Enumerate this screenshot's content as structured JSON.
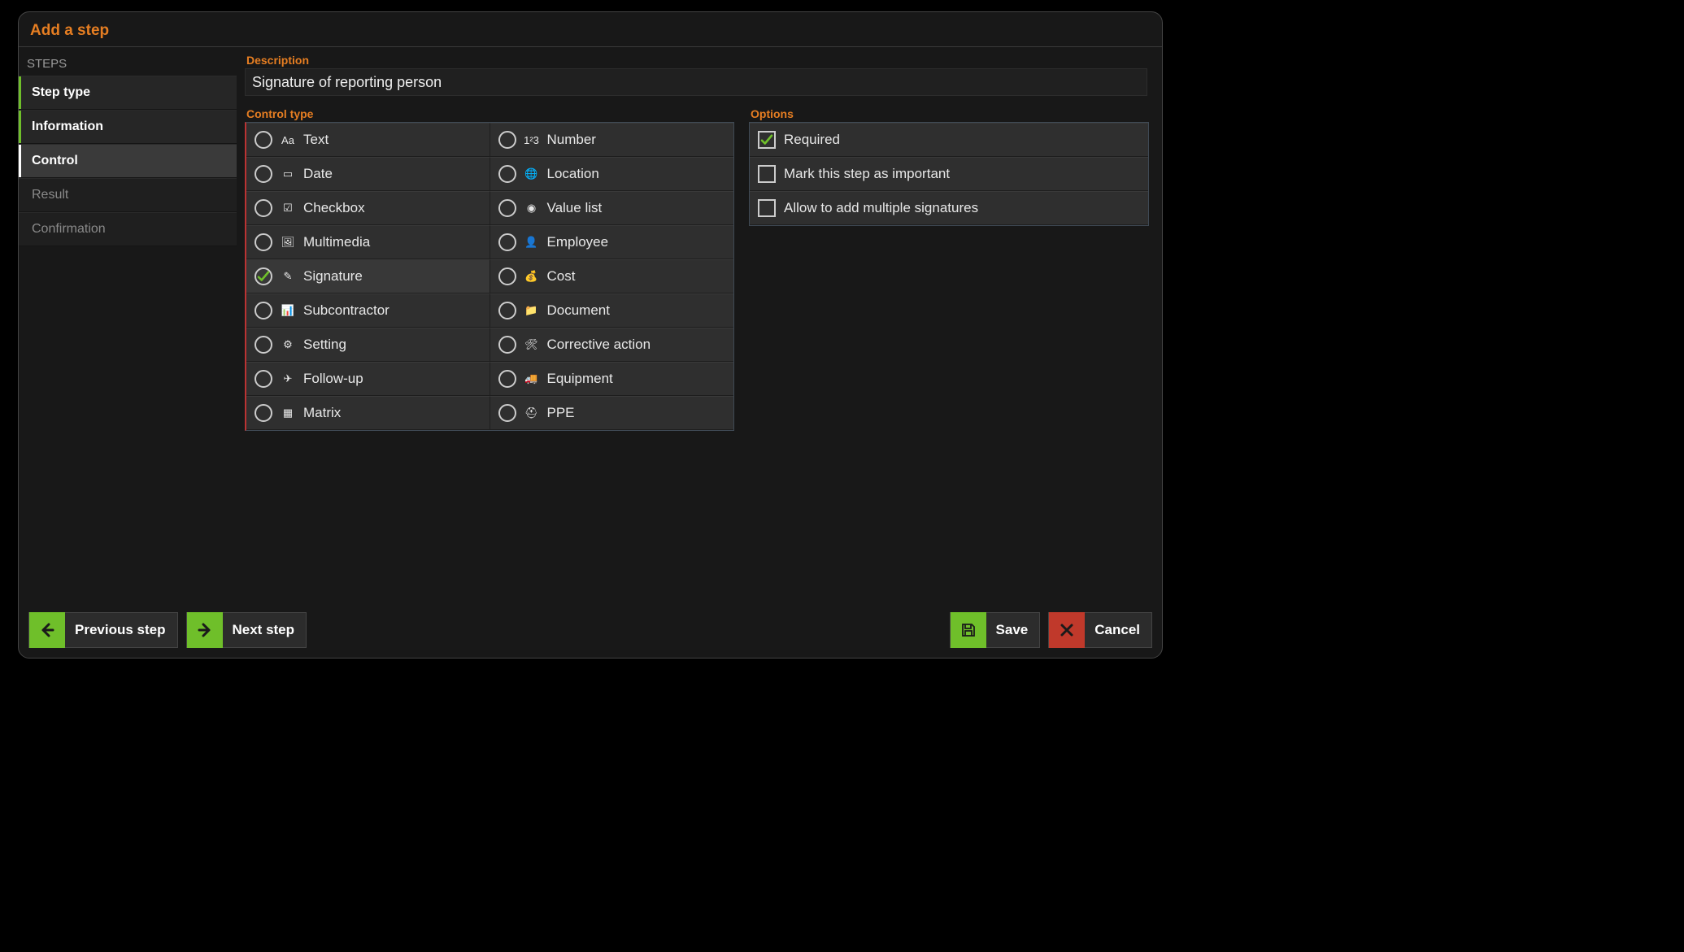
{
  "title": "Add a step",
  "sidebar": {
    "heading": "STEPS",
    "items": [
      {
        "label": "Step type",
        "state": "done"
      },
      {
        "label": "Information",
        "state": "done"
      },
      {
        "label": "Control",
        "state": "current"
      },
      {
        "label": "Result",
        "state": "future"
      },
      {
        "label": "Confirmation",
        "state": "future"
      }
    ]
  },
  "description": {
    "label": "Description",
    "value": "Signature of reporting person"
  },
  "control_type": {
    "label": "Control type",
    "selected": "Signature",
    "items": [
      {
        "label": "Text",
        "icon": "text-icon"
      },
      {
        "label": "Number",
        "icon": "number-icon"
      },
      {
        "label": "Date",
        "icon": "date-icon"
      },
      {
        "label": "Location",
        "icon": "location-icon"
      },
      {
        "label": "Checkbox",
        "icon": "checkbox-icon"
      },
      {
        "label": "Value list",
        "icon": "valuelist-icon"
      },
      {
        "label": "Multimedia",
        "icon": "multimedia-icon"
      },
      {
        "label": "Employee",
        "icon": "employee-icon"
      },
      {
        "label": "Signature",
        "icon": "signature-icon"
      },
      {
        "label": "Cost",
        "icon": "cost-icon"
      },
      {
        "label": "Subcontractor",
        "icon": "subcontractor-icon"
      },
      {
        "label": "Document",
        "icon": "document-icon"
      },
      {
        "label": "Setting",
        "icon": "setting-icon"
      },
      {
        "label": "Corrective action",
        "icon": "corrective-icon"
      },
      {
        "label": "Follow-up",
        "icon": "followup-icon"
      },
      {
        "label": "Equipment",
        "icon": "equipment-icon"
      },
      {
        "label": "Matrix",
        "icon": "matrix-icon"
      },
      {
        "label": "PPE",
        "icon": "ppe-icon"
      }
    ]
  },
  "options": {
    "label": "Options",
    "items": [
      {
        "label": "Required",
        "checked": true
      },
      {
        "label": "Mark this step as important",
        "checked": false
      },
      {
        "label": "Allow to add multiple signatures",
        "checked": false
      }
    ]
  },
  "footer": {
    "prev": "Previous step",
    "next": "Next step",
    "save": "Save",
    "cancel": "Cancel"
  },
  "icons": {
    "text-icon": "Aa",
    "number-icon": "1²3",
    "date-icon": "▭",
    "location-icon": "🌐",
    "checkbox-icon": "☑",
    "valuelist-icon": "◉",
    "multimedia-icon": "🖼",
    "employee-icon": "👤",
    "signature-icon": "✎",
    "cost-icon": "💰",
    "subcontractor-icon": "📊",
    "document-icon": "📁",
    "setting-icon": "⚙",
    "corrective-icon": "🛠",
    "followup-icon": "✈",
    "equipment-icon": "🚚",
    "matrix-icon": "▦",
    "ppe-icon": "⛑"
  }
}
